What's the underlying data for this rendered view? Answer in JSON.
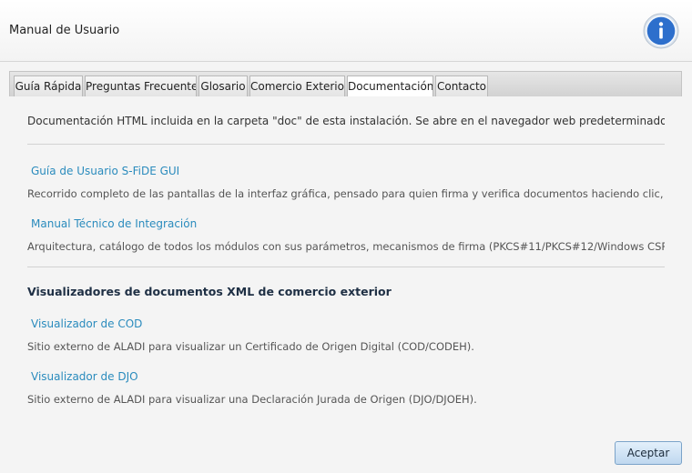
{
  "window": {
    "title": "Manual de Usuario",
    "info_icon": "info-icon"
  },
  "tabs": [
    {
      "label": "Guía Rápida",
      "active": false
    },
    {
      "label": "Preguntas Frecuentes",
      "active": false
    },
    {
      "label": "Glosario",
      "active": false
    },
    {
      "label": "Comercio Exterior",
      "active": false
    },
    {
      "label": "Documentación",
      "active": true
    },
    {
      "label": "Contacto",
      "active": false
    }
  ],
  "documentation": {
    "intro": "Documentación HTML incluida en la carpeta \"doc\" de esta instalación. Se abre en el navegador web predeterminado del sistema ...",
    "links": [
      {
        "title": "Guía de Usuario S-FiDE GUI",
        "description": "Recorrido completo de las pantallas de la interfaz gráfica, pensado para quien firma y verifica documentos haciendo clic, no por ..."
      },
      {
        "title": "Manual Técnico de Integración",
        "description": "Arquitectura, catálogo de todos los módulos con sus parámetros, mecanismos de firma (PKCS#11/PKCS#12/Windows CSP-KSP) y ..."
      }
    ],
    "section_title": "Visualizadores de documentos XML de comercio exterior",
    "viewers": [
      {
        "title": "Visualizador de COD",
        "description": "Sitio externo de ALADI para visualizar un Certificado de Origen Digital (COD/CODEH)."
      },
      {
        "title": "Visualizador de DJO",
        "description": "Sitio externo de ALADI para visualizar una Declaración Jurada de Origen (DJO/DJOEH)."
      }
    ]
  },
  "footer": {
    "accept_label": "Aceptar"
  },
  "colors": {
    "link": "#2a8bbd",
    "info_icon_fill": "#2d6fcc",
    "accept_button_border": "#7ba3c9"
  }
}
